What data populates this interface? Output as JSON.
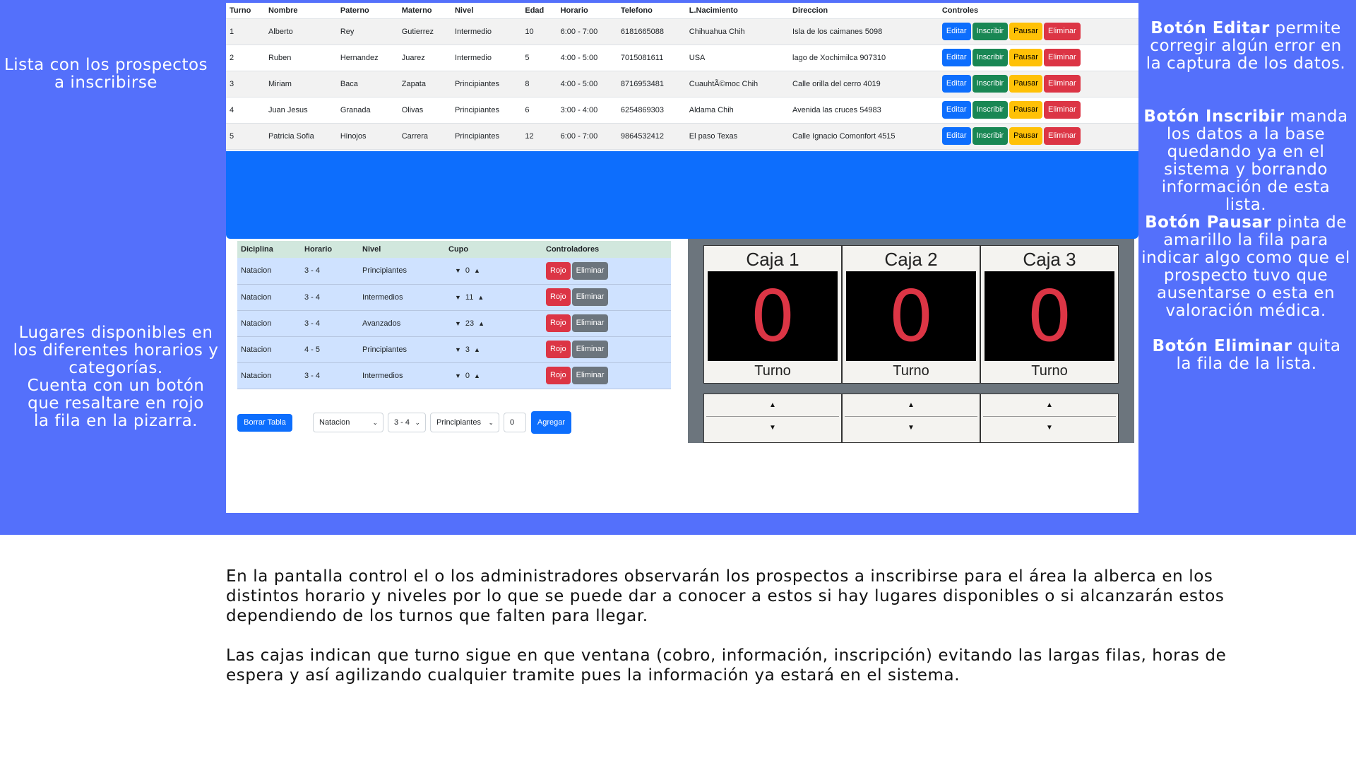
{
  "annotations": {
    "list_note": "Lista con los prospectos\na inscribirse",
    "places_note": "Lugares disponibles en\nlos diferentes horarios y\ncategorías.\nCuenta con un botón\nque resaltare en rojo\nla fila en la pizarra.",
    "editar_title": "Botón Editar",
    "editar_text": "permite corregir algún error en la captura de los datos.",
    "inscribir_title": "Botón Inscribir",
    "inscribir_text": "manda los datos a la base quedando ya en el sistema y borrando información de esta lista.",
    "pausar_title": "Botón Pausar",
    "pausar_text": "pinta de amarillo la fila para indicar algo como que el prospecto tuvo que ausentarse o esta en valoración médica.",
    "eliminar_title": "Botón Eliminar",
    "eliminar_text": "quita la fila de la lista."
  },
  "prospects": {
    "headers": [
      "Turno",
      "Nombre",
      "Paterno",
      "Materno",
      "Nivel",
      "Edad",
      "Horario",
      "Telefono",
      "L.Nacimiento",
      "Direccion",
      "Controles"
    ],
    "rows": [
      [
        "1",
        "Alberto",
        "Rey",
        "Gutierrez",
        "Intermedio",
        "10",
        "6:00 - 7:00",
        "6181665088",
        "Chihuahua Chih",
        "Isla de los caimanes 5098"
      ],
      [
        "2",
        "Ruben",
        "Hernandez",
        "Juarez",
        "Intermedio",
        "5",
        "4:00 - 5:00",
        "7015081611",
        "USA",
        "lago de Xochimilca 907310"
      ],
      [
        "3",
        "Miriam",
        "Baca",
        "Zapata",
        "Principiantes",
        "8",
        "4:00 - 5:00",
        "8716953481",
        "CuauhtÃ©moc Chih",
        "Calle orilla del cerro 4019"
      ],
      [
        "4",
        "Juan Jesus",
        "Granada",
        "Olivas",
        "Principiantes",
        "6",
        "3:00 - 4:00",
        "6254869303",
        "Aldama Chih",
        "Avenida las cruces 54983"
      ],
      [
        "5",
        "Patricia Sofia",
        "Hinojos",
        "Carrera",
        "Principiantes",
        "12",
        "6:00 - 7:00",
        "9864532412",
        "El paso Texas",
        "Calle Ignacio Comonfort 4515"
      ]
    ],
    "buttons": {
      "edit": "Editar",
      "enroll": "Inscribir",
      "pause": "Pausar",
      "delete": "Eliminar"
    }
  },
  "places": {
    "headers": [
      "Diciplina",
      "Horario",
      "Nivel",
      "Cupo",
      "Controladores"
    ],
    "rows": [
      [
        "Natacion",
        "3 - 4",
        "Principiantes",
        "0"
      ],
      [
        "Natacion",
        "3 - 4",
        "Intermedios",
        "11"
      ],
      [
        "Natacion",
        "3 - 4",
        "Avanzados",
        "23"
      ],
      [
        "Natacion",
        "4 - 5",
        "Principiantes",
        "3"
      ],
      [
        "Natacion",
        "3 - 4",
        "Intermedios",
        "0"
      ]
    ],
    "buttons": {
      "red": "Rojo",
      "delete": "Eliminar"
    }
  },
  "form": {
    "clear_label": "Borrar Tabla",
    "discipline": "Natacion",
    "schedule": "3 - 4",
    "level": "Principiantes",
    "quota": "0",
    "add_label": "Agregar"
  },
  "boxes": [
    {
      "title": "Caja 1",
      "number": "0",
      "footer": "Turno"
    },
    {
      "title": "Caja 2",
      "number": "0",
      "footer": "Turno"
    },
    {
      "title": "Caja 3",
      "number": "0",
      "footer": "Turno"
    }
  ],
  "description": {
    "p1": "En la pantalla control el o los administradores observarán los prospectos a inscribirse para el área la alberca en los distintos horario y niveles por lo que se puede dar a conocer a estos si hay lugares disponibles o si alcanzarán estos dependiendo de los turnos que falten para llegar.",
    "p2": "Las cajas indican que turno sigue en que ventana (cobro, información, inscripción) evitando las largas filas, horas de espera y así agilizando cualquier tramite pues la información ya estará en el sistema."
  },
  "colors": {
    "band": "#5470fb",
    "primary": "#0d6efd",
    "success": "#198754",
    "warning": "#ffc107",
    "danger": "#dc3545",
    "secondary": "#6c757d"
  }
}
